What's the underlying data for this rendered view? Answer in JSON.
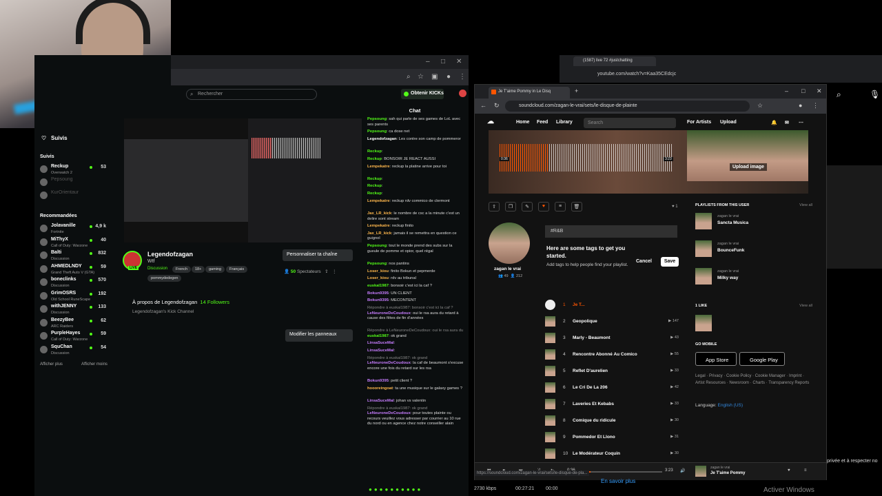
{
  "kick": {
    "window_controls": [
      "–",
      "□",
      "✕"
    ],
    "search_placeholder": "Rechercher",
    "kicks_button": "Obtenir KICKs",
    "sidebar": {
      "suivis_header": "Suivis",
      "suivis_label": "Suivis",
      "followed": [
        {
          "name": "Reckup",
          "game": "Overwatch 2",
          "count": "53",
          "online": true
        },
        {
          "name": "Pepsoung",
          "game": "",
          "count": "",
          "online": false
        },
        {
          "name": "KurOrientaur",
          "game": "",
          "count": "",
          "online": false
        }
      ],
      "recommended_label": "Recommandées",
      "recommended": [
        {
          "name": "Jolavanille",
          "game": "Fortnite",
          "count": "4,9 k"
        },
        {
          "name": "MiThyX",
          "game": "Call of Duty: Warzone",
          "count": "40"
        },
        {
          "name": "Balti",
          "game": "Discussion",
          "count": "832"
        },
        {
          "name": "AHMEDLNDY",
          "game": "Grand Theft Auto V (GTA)",
          "count": "59"
        },
        {
          "name": "boneclinks",
          "game": "Discussion",
          "count": "570"
        },
        {
          "name": "GrimOSRS",
          "game": "Old School RuneScape",
          "count": "192"
        },
        {
          "name": "withJENNY",
          "game": "Discussion",
          "count": "133"
        },
        {
          "name": "BeezyBee",
          "game": "ARC Raiders",
          "count": "62"
        },
        {
          "name": "PurpleHayes",
          "game": "Call of Duty: Warzone",
          "count": "59"
        },
        {
          "name": "SquChan",
          "game": "Discussion",
          "count": "54"
        }
      ],
      "show_more": "Afficher plus",
      "show_less": "Afficher moins"
    },
    "channel": {
      "live_badge": "LIVE",
      "name": "Legendofzagan",
      "title": "Wtf",
      "category": "Discussion",
      "tags": [
        "French",
        "18+",
        "gaming",
        "Français",
        "pommydedegen"
      ],
      "customize_button": "Personnaliser ta chaîne",
      "viewers_count": "50",
      "viewers_label": "Spectateurs",
      "about_label": "À propos de Legendofzagan",
      "followers_count": "14",
      "followers_label": "Followers",
      "about_sub": "Legendofzagan's Kick Channel",
      "edit_panels": "Modifier les panneaux"
    },
    "chat": {
      "header": "Chat",
      "messages": [
        {
          "user": "Pepsoung",
          "color": "#53fc18",
          "text": "sah qui parle de ses games de LoL avec ses parents"
        },
        {
          "user": "Pepsoung",
          "color": "#53fc18",
          "text": "ca dose net"
        },
        {
          "user": "Legendofzagan",
          "color": "#ffffff",
          "text": "Les contre son camp de pommeror"
        },
        {
          "user": "Reckup",
          "color": "#53fc18",
          "text": ""
        },
        {
          "user": "Reckup",
          "color": "#53fc18",
          "text": "BONSOIR JE REACT AUSSI"
        },
        {
          "user": "Lempekatre",
          "color": "#ffb84d",
          "text": "reckup la platine arrive pour toi"
        },
        {
          "user": "Reckup",
          "color": "#53fc18",
          "text": ""
        },
        {
          "user": "Reckup",
          "color": "#53fc18",
          "text": ""
        },
        {
          "user": "Reckup",
          "color": "#53fc18",
          "text": ""
        },
        {
          "user": "Lempekatre",
          "color": "#ffb84d",
          "text": "reckup rdv commico de clermont"
        },
        {
          "user": "Jax_LR_kick",
          "color": "#ffb84d",
          "text": "le nombre de csc a la minute c'est un delire sont stream"
        },
        {
          "user": "Lempekatre",
          "color": "#ffb84d",
          "text": "reckup finito"
        },
        {
          "user": "Jax_LR_kick",
          "color": "#ffb84d",
          "text": "jamais il se remettra en question ce guignol"
        },
        {
          "user": "Pepsoung",
          "color": "#53fc18",
          "text": "tout le monde prend des subs sur la gueule de pomme et opior, quel régal"
        },
        {
          "user": "Pepsoung",
          "color": "#53fc18",
          "text": "nos pantins"
        },
        {
          "user": "Loser_kiou",
          "color": "#ffb84d",
          "text": "finito Bokun et pepmerde"
        },
        {
          "user": "Loser_kiou",
          "color": "#ffb84d",
          "text": "rdv au tribunal"
        },
        {
          "user": "euskal1987",
          "color": "#53fc18",
          "text": "bonsoir c'est ici la caf ?"
        },
        {
          "user": "Bokun9395",
          "color": "#c77dff",
          "text": "UN CLIENT"
        },
        {
          "user": "Bokun9395",
          "color": "#c77dff",
          "text": "MECONTENT"
        },
        {
          "user": "LeNeuroneDeCoudoux",
          "color": "#c77dff",
          "text": "oui le rsa aura du retard à cause des fêtes de fin d'années",
          "reply": "Répondre à euskal1987: bonsoir c'est ici la caf ?"
        },
        {
          "user": "euskal1987",
          "color": "#53fc18",
          "text": "ok grand",
          "reply": "Répondre à LeNeuroneDeCoudoux: oui le rsa aura du"
        },
        {
          "user": "LinsaSuceMal",
          "color": "#c77dff",
          "text": ""
        },
        {
          "user": "LinsaSuceMal",
          "color": "#c77dff",
          "text": ""
        },
        {
          "user": "LeNeuroneDeCoudoux",
          "color": "#c77dff",
          "text": "la caf de beaumont s'excuse encore une fois du retard sur les rsa",
          "reply": "Répondre à euskal1987: ok grand"
        },
        {
          "user": "Bokun9395",
          "color": "#c77dff",
          "text": "petit client ?"
        },
        {
          "user": "hoooreingoat",
          "color": "#ffb84d",
          "text": "ta une musique sur le galaxy games ?"
        },
        {
          "user": "LinsaSuceMal",
          "color": "#c77dff",
          "text": "johan vs valentin"
        },
        {
          "user": "LeNeuroneDeCoudoux",
          "color": "#c77dff",
          "text": "pour toutes plainte ou recours veuillez vous adresser par courrier au 10 rue du nord ou en agence chez notre conseiller alain",
          "reply": "Répondre à euskal1987: ok grand"
        }
      ]
    }
  },
  "youtube": {
    "tab_title": "(1587) live 72 #justchatting",
    "url": "youtube.com/watch?v=Kaa35CEdcjc"
  },
  "soundcloud": {
    "tab_title": "Je T'aime Pommy in Le Disq",
    "url": "soundcloud.com/zagan-le-vrai/sets/le-disque-de-plainte",
    "nav": {
      "home": "Home",
      "feed": "Feed",
      "library": "Library",
      "search_placeholder": "Search",
      "for_artists": "For Artists",
      "upload": "Upload"
    },
    "banner": {
      "upload_image": "Upload image",
      "time_start": "0:36",
      "time_end": "3:23"
    },
    "likes_count": "1",
    "artist": {
      "name": "zagan le vrai",
      "followers": "49",
      "following": "212"
    },
    "tags": {
      "input_value": "#R&B",
      "title": "Here are some tags to get you started.",
      "subtitle": "Add tags to help people find your playlist.",
      "cancel": "Cancel",
      "save": "Save"
    },
    "tracks": [
      {
        "num": "1",
        "title": "Je T...",
        "plays": "",
        "playing": true
      },
      {
        "num": "2",
        "title": "Geopolique",
        "plays": "147"
      },
      {
        "num": "3",
        "title": "Marly - Beaumont",
        "plays": "43"
      },
      {
        "num": "4",
        "title": "Rencontre Abonné Au Comico",
        "plays": "55"
      },
      {
        "num": "5",
        "title": "Reflet D'aurelien",
        "plays": "33"
      },
      {
        "num": "6",
        "title": "Le Cri De La 206",
        "plays": "42"
      },
      {
        "num": "7",
        "title": "Laveries Et Kebabs",
        "plays": "33"
      },
      {
        "num": "8",
        "title": "Comique du ridicule",
        "plays": "30"
      },
      {
        "num": "9",
        "title": "Pommedor Et Llono",
        "plays": "31"
      },
      {
        "num": "10",
        "title": "Le Modérateur Coquin",
        "plays": "30"
      }
    ],
    "sidebar": {
      "playlists_header": "PLAYLISTS FROM THIS USER",
      "view_all": "View all",
      "playlists": [
        {
          "by": "zagan le vrai",
          "name": "Sancta Musica"
        },
        {
          "by": "zagan le vrai",
          "name": "BounceFunk"
        },
        {
          "by": "zagan le vrai",
          "name": "Milky way"
        }
      ],
      "like_header": "1 LIKE",
      "go_mobile": "GO MOBILE",
      "app_store": "App Store",
      "google_play": "Google Play",
      "legal": "Legal · Privacy · Cookie Policy · Cookie Manager · Imprint · Artist Resources · Newsroom · Charts · Transparency Reports",
      "language_label": "Language:",
      "language_value": "English (US)"
    },
    "player": {
      "elapsed": "0:36",
      "duration": "3:23",
      "artist": "zagan le vrai",
      "track": "Je T'aime Pommy"
    },
    "status_url": "https://soundcloud.com/zagan-le-vrai/sets/le-disque-de-pla..."
  },
  "system": {
    "bitrate": "2730 kbps",
    "timer": "00:27:21",
    "timer2": "00:00",
    "en_savoir_plus": "En savoir plus",
    "activer_windows": "Activer Windows",
    "privee": "privée et à respecter no"
  },
  "colors": {
    "kick_green": "#53fc18",
    "soundcloud_orange": "#ff5500"
  }
}
